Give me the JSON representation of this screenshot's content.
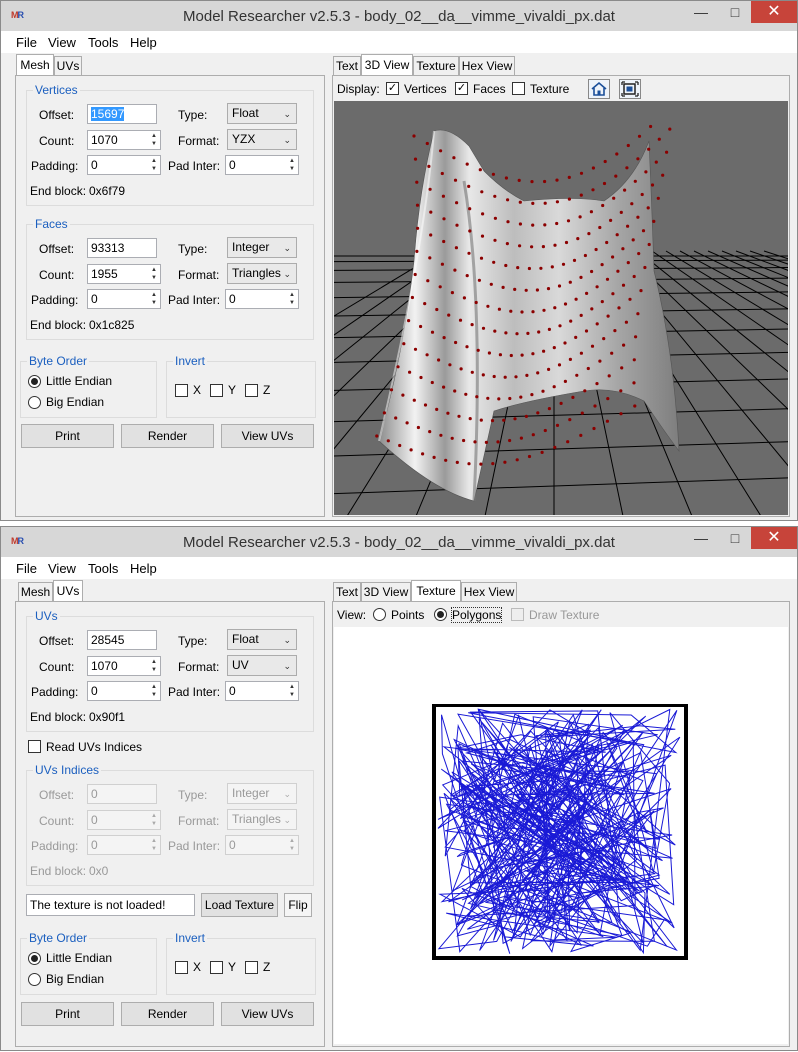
{
  "windows": [
    {
      "title": "Model Researcher v2.5.3 - body_02__da__vimme_vivaldi_px.dat",
      "menu": [
        "File",
        "View",
        "Tools",
        "Help"
      ],
      "left_tabs": [
        "Mesh",
        "UVs"
      ],
      "vertices": {
        "label": "Vertices",
        "offset_label": "Offset:",
        "offset": "15697",
        "count_label": "Count:",
        "count": "1070",
        "padding_label": "Padding:",
        "padding": "0",
        "type_label": "Type:",
        "type": "Float",
        "format_label": "Format:",
        "format": "YZX",
        "padinter_label": "Pad Inter:",
        "padinter": "0",
        "endblock_label": "End block:",
        "endblock": "0x6f79"
      },
      "faces": {
        "label": "Faces",
        "offset_label": "Offset:",
        "offset": "93313",
        "count_label": "Count:",
        "count": "1955",
        "padding_label": "Padding:",
        "padding": "0",
        "type_label": "Type:",
        "type": "Integer",
        "format_label": "Format:",
        "format": "Triangles",
        "padinter_label": "Pad Inter:",
        "padinter": "0",
        "endblock_label": "End block:",
        "endblock": "0x1c825"
      },
      "byte_order": {
        "label": "Byte Order",
        "little": "Little Endian",
        "big": "Big Endian"
      },
      "invert": {
        "label": "Invert",
        "x": "X",
        "y": "Y",
        "z": "Z"
      },
      "buttons": {
        "print": "Print",
        "render": "Render",
        "view_uvs": "View UVs"
      },
      "right_tabs": [
        "Text",
        "3D View",
        "Texture",
        "Hex View"
      ],
      "display": {
        "label": "Display:",
        "vertices": "Vertices",
        "faces": "Faces",
        "texture": "Texture"
      }
    },
    {
      "title": "Model Researcher v2.5.3 - body_02__da__vimme_vivaldi_px.dat",
      "menu": [
        "File",
        "View",
        "Tools",
        "Help"
      ],
      "left_tabs": [
        "Mesh",
        "UVs"
      ],
      "uvs": {
        "label": "UVs",
        "offset_label": "Offset:",
        "offset": "28545",
        "count_label": "Count:",
        "count": "1070",
        "padding_label": "Padding:",
        "padding": "0",
        "type_label": "Type:",
        "type": "Float",
        "format_label": "Format:",
        "format": "UV",
        "padinter_label": "Pad Inter:",
        "padinter": "0",
        "endblock_label": "End block:",
        "endblock": "0x90f1"
      },
      "read_indices": "Read UVs Indices",
      "uv_indices": {
        "label": "UVs Indices",
        "offset_label": "Offset:",
        "offset": "0",
        "count_label": "Count:",
        "count": "0",
        "padding_label": "Padding:",
        "padding": "0",
        "type_label": "Type:",
        "type": "Integer",
        "format_label": "Format:",
        "format": "Triangles",
        "padinter_label": "Pad Inter:",
        "padinter": "0",
        "endblock_label": "End block:",
        "endblock": "0x0"
      },
      "texture_status": "The texture is not loaded!",
      "load_texture": "Load Texture",
      "flip": "Flip",
      "byte_order": {
        "label": "Byte Order",
        "little": "Little Endian",
        "big": "Big Endian"
      },
      "invert": {
        "label": "Invert",
        "x": "X",
        "y": "Y",
        "z": "Z"
      },
      "buttons": {
        "print": "Print",
        "render": "Render",
        "view_uvs": "View UVs"
      },
      "right_tabs": [
        "Text",
        "3D View",
        "Texture",
        "Hex View"
      ],
      "view": {
        "label": "View:",
        "points": "Points",
        "polygons": "Polygons",
        "draw_texture": "Draw Texture"
      }
    }
  ],
  "colors": {
    "accent_label": "#1b5fbf",
    "close_button": "#c7443a",
    "viewport_bg": "#6b6b6b",
    "vertex_dots": "#8b0000",
    "uv_lines": "#1a1ad6"
  }
}
